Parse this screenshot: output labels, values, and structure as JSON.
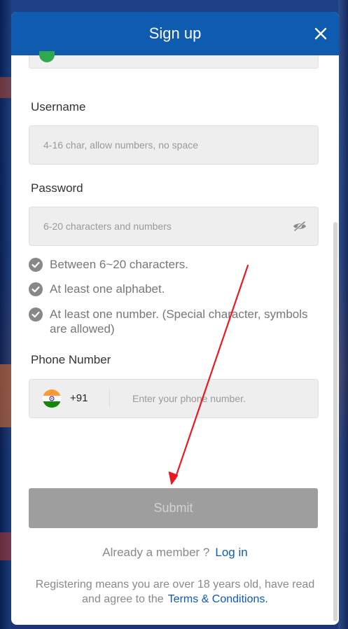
{
  "modal": {
    "title": "Sign up"
  },
  "username": {
    "label": "Username",
    "placeholder": "4-16 char, allow numbers, no space",
    "value": ""
  },
  "password": {
    "label": "Password",
    "placeholder": "6-20 characters and numbers",
    "value": "",
    "icon": "eye-slash-icon"
  },
  "password_rules": [
    {
      "text": "Between 6~20 characters.",
      "met": true
    },
    {
      "text": "At least one alphabet.",
      "met": true
    },
    {
      "text": "At least one number. (Special character, symbols are allowed)",
      "met": true
    }
  ],
  "phone": {
    "label": "Phone Number",
    "country_flag": "india-flag-icon",
    "country_code": "+91",
    "placeholder": "Enter your phone number.",
    "value": ""
  },
  "submit": {
    "label": "Submit",
    "enabled": false
  },
  "login": {
    "prompt": "Already a member ?",
    "link": "Log in"
  },
  "terms": {
    "text": "Registering means you are over 18 years old, have read and agree to the",
    "link": "Terms & Conditions."
  },
  "colors": {
    "header": "#0f5bb0",
    "link": "#0f5bb0",
    "submit_disabled": "#9e9e9e",
    "annotation_arrow": "#e8191f",
    "check": "#888888"
  }
}
